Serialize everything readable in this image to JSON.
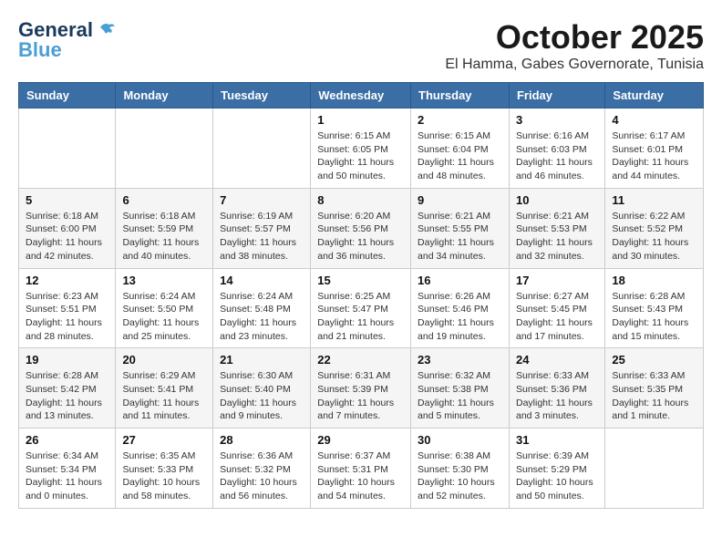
{
  "logo": {
    "line1": "General",
    "line2": "Blue"
  },
  "title": "October 2025",
  "location": "El Hamma, Gabes Governorate, Tunisia",
  "days_of_week": [
    "Sunday",
    "Monday",
    "Tuesday",
    "Wednesday",
    "Thursday",
    "Friday",
    "Saturday"
  ],
  "weeks": [
    [
      {
        "day": "",
        "info": ""
      },
      {
        "day": "",
        "info": ""
      },
      {
        "day": "",
        "info": ""
      },
      {
        "day": "1",
        "info": "Sunrise: 6:15 AM\nSunset: 6:05 PM\nDaylight: 11 hours\nand 50 minutes."
      },
      {
        "day": "2",
        "info": "Sunrise: 6:15 AM\nSunset: 6:04 PM\nDaylight: 11 hours\nand 48 minutes."
      },
      {
        "day": "3",
        "info": "Sunrise: 6:16 AM\nSunset: 6:03 PM\nDaylight: 11 hours\nand 46 minutes."
      },
      {
        "day": "4",
        "info": "Sunrise: 6:17 AM\nSunset: 6:01 PM\nDaylight: 11 hours\nand 44 minutes."
      }
    ],
    [
      {
        "day": "5",
        "info": "Sunrise: 6:18 AM\nSunset: 6:00 PM\nDaylight: 11 hours\nand 42 minutes."
      },
      {
        "day": "6",
        "info": "Sunrise: 6:18 AM\nSunset: 5:59 PM\nDaylight: 11 hours\nand 40 minutes."
      },
      {
        "day": "7",
        "info": "Sunrise: 6:19 AM\nSunset: 5:57 PM\nDaylight: 11 hours\nand 38 minutes."
      },
      {
        "day": "8",
        "info": "Sunrise: 6:20 AM\nSunset: 5:56 PM\nDaylight: 11 hours\nand 36 minutes."
      },
      {
        "day": "9",
        "info": "Sunrise: 6:21 AM\nSunset: 5:55 PM\nDaylight: 11 hours\nand 34 minutes."
      },
      {
        "day": "10",
        "info": "Sunrise: 6:21 AM\nSunset: 5:53 PM\nDaylight: 11 hours\nand 32 minutes."
      },
      {
        "day": "11",
        "info": "Sunrise: 6:22 AM\nSunset: 5:52 PM\nDaylight: 11 hours\nand 30 minutes."
      }
    ],
    [
      {
        "day": "12",
        "info": "Sunrise: 6:23 AM\nSunset: 5:51 PM\nDaylight: 11 hours\nand 28 minutes."
      },
      {
        "day": "13",
        "info": "Sunrise: 6:24 AM\nSunset: 5:50 PM\nDaylight: 11 hours\nand 25 minutes."
      },
      {
        "day": "14",
        "info": "Sunrise: 6:24 AM\nSunset: 5:48 PM\nDaylight: 11 hours\nand 23 minutes."
      },
      {
        "day": "15",
        "info": "Sunrise: 6:25 AM\nSunset: 5:47 PM\nDaylight: 11 hours\nand 21 minutes."
      },
      {
        "day": "16",
        "info": "Sunrise: 6:26 AM\nSunset: 5:46 PM\nDaylight: 11 hours\nand 19 minutes."
      },
      {
        "day": "17",
        "info": "Sunrise: 6:27 AM\nSunset: 5:45 PM\nDaylight: 11 hours\nand 17 minutes."
      },
      {
        "day": "18",
        "info": "Sunrise: 6:28 AM\nSunset: 5:43 PM\nDaylight: 11 hours\nand 15 minutes."
      }
    ],
    [
      {
        "day": "19",
        "info": "Sunrise: 6:28 AM\nSunset: 5:42 PM\nDaylight: 11 hours\nand 13 minutes."
      },
      {
        "day": "20",
        "info": "Sunrise: 6:29 AM\nSunset: 5:41 PM\nDaylight: 11 hours\nand 11 minutes."
      },
      {
        "day": "21",
        "info": "Sunrise: 6:30 AM\nSunset: 5:40 PM\nDaylight: 11 hours\nand 9 minutes."
      },
      {
        "day": "22",
        "info": "Sunrise: 6:31 AM\nSunset: 5:39 PM\nDaylight: 11 hours\nand 7 minutes."
      },
      {
        "day": "23",
        "info": "Sunrise: 6:32 AM\nSunset: 5:38 PM\nDaylight: 11 hours\nand 5 minutes."
      },
      {
        "day": "24",
        "info": "Sunrise: 6:33 AM\nSunset: 5:36 PM\nDaylight: 11 hours\nand 3 minutes."
      },
      {
        "day": "25",
        "info": "Sunrise: 6:33 AM\nSunset: 5:35 PM\nDaylight: 11 hours\nand 1 minute."
      }
    ],
    [
      {
        "day": "26",
        "info": "Sunrise: 6:34 AM\nSunset: 5:34 PM\nDaylight: 11 hours\nand 0 minutes."
      },
      {
        "day": "27",
        "info": "Sunrise: 6:35 AM\nSunset: 5:33 PM\nDaylight: 10 hours\nand 58 minutes."
      },
      {
        "day": "28",
        "info": "Sunrise: 6:36 AM\nSunset: 5:32 PM\nDaylight: 10 hours\nand 56 minutes."
      },
      {
        "day": "29",
        "info": "Sunrise: 6:37 AM\nSunset: 5:31 PM\nDaylight: 10 hours\nand 54 minutes."
      },
      {
        "day": "30",
        "info": "Sunrise: 6:38 AM\nSunset: 5:30 PM\nDaylight: 10 hours\nand 52 minutes."
      },
      {
        "day": "31",
        "info": "Sunrise: 6:39 AM\nSunset: 5:29 PM\nDaylight: 10 hours\nand 50 minutes."
      },
      {
        "day": "",
        "info": ""
      }
    ]
  ]
}
